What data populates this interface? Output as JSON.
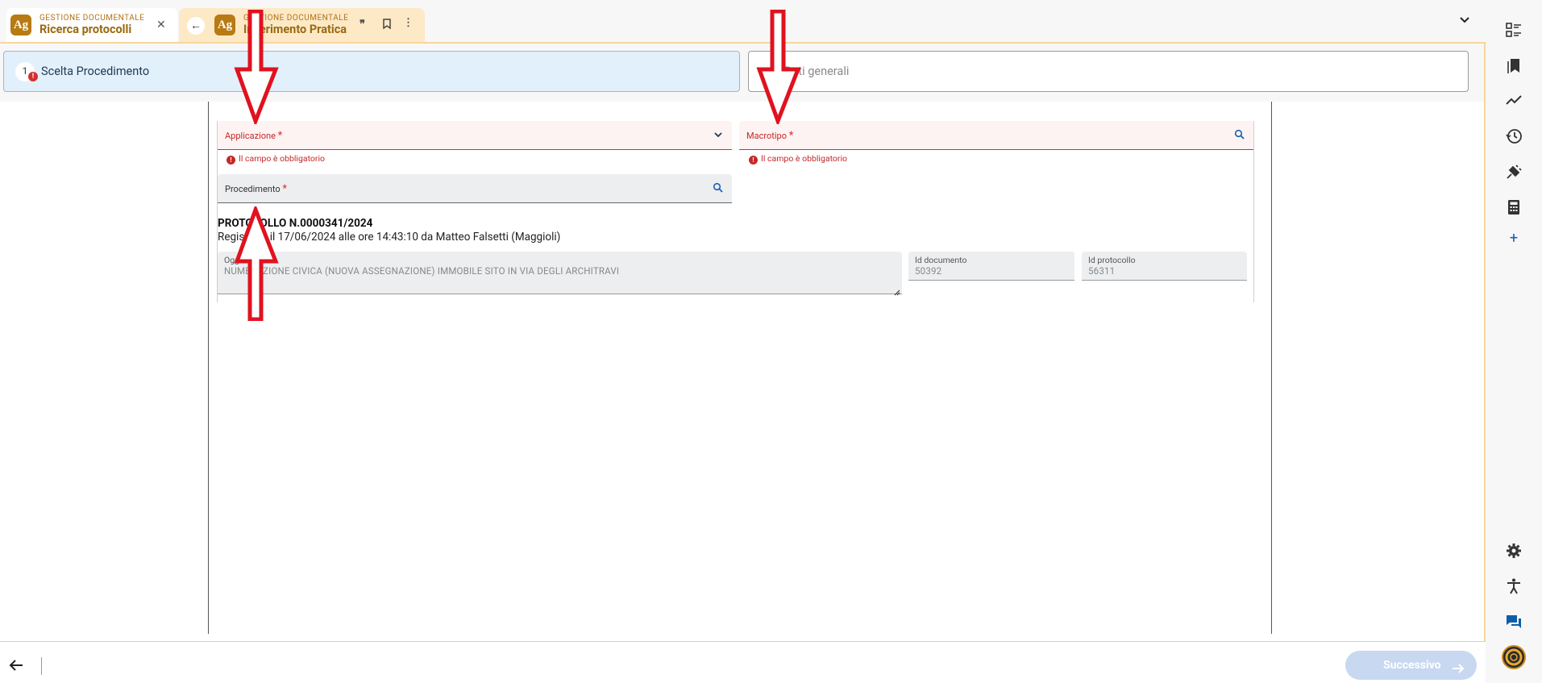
{
  "tabs": [
    {
      "app": "GESTIONE DOCUMENTALE",
      "title": "Ricerca protocolli",
      "logo": "Ag"
    },
    {
      "app": "GESTIONE DOCUMENTALE",
      "title": "Inserimento Pratica",
      "logo": "Ag"
    }
  ],
  "steps": [
    {
      "number": "1",
      "label": "Scelta Procedimento",
      "active": true,
      "error": true
    },
    {
      "label": "Dati generali",
      "active": false
    }
  ],
  "form": {
    "applicazione_label": "Applicazione",
    "macrotipo_label": "Macrotipo",
    "procedimento_label": "Procedimento",
    "required_mark": "*",
    "error_text": "Il campo è obbligatorio"
  },
  "protocol": {
    "title": "PROTOCOLLO N.0000341/2024",
    "subtitle": "Registrato il 17/06/2024 alle ore 14:43:10 da Matteo Falsetti (Maggioli)",
    "oggetto_label": "Oggetto",
    "oggetto_value": "NUMERAZIONE CIVICA (NUOVA ASSEGNAZIONE) IMMOBILE SITO IN VIA DEGLI ARCHITRAVI",
    "id_documento_label": "Id documento",
    "id_documento_value": "50392",
    "id_protocollo_label": "Id protocollo",
    "id_protocollo_value": "56311"
  },
  "footer": {
    "next_label": "Successivo"
  },
  "sidebar": {
    "icons": [
      "checklist-icon",
      "bookmarks-icon",
      "trending-icon",
      "history-icon",
      "plugin-icon",
      "calculator-icon",
      "plus-icon",
      "settings-icon",
      "accessibility-icon",
      "chat-icon",
      "support-icon"
    ]
  },
  "colors": {
    "accent": "#b87a12",
    "error": "#d32f2f",
    "step_active_bg": "#e2f0fb",
    "annotation": "#e0121f"
  }
}
